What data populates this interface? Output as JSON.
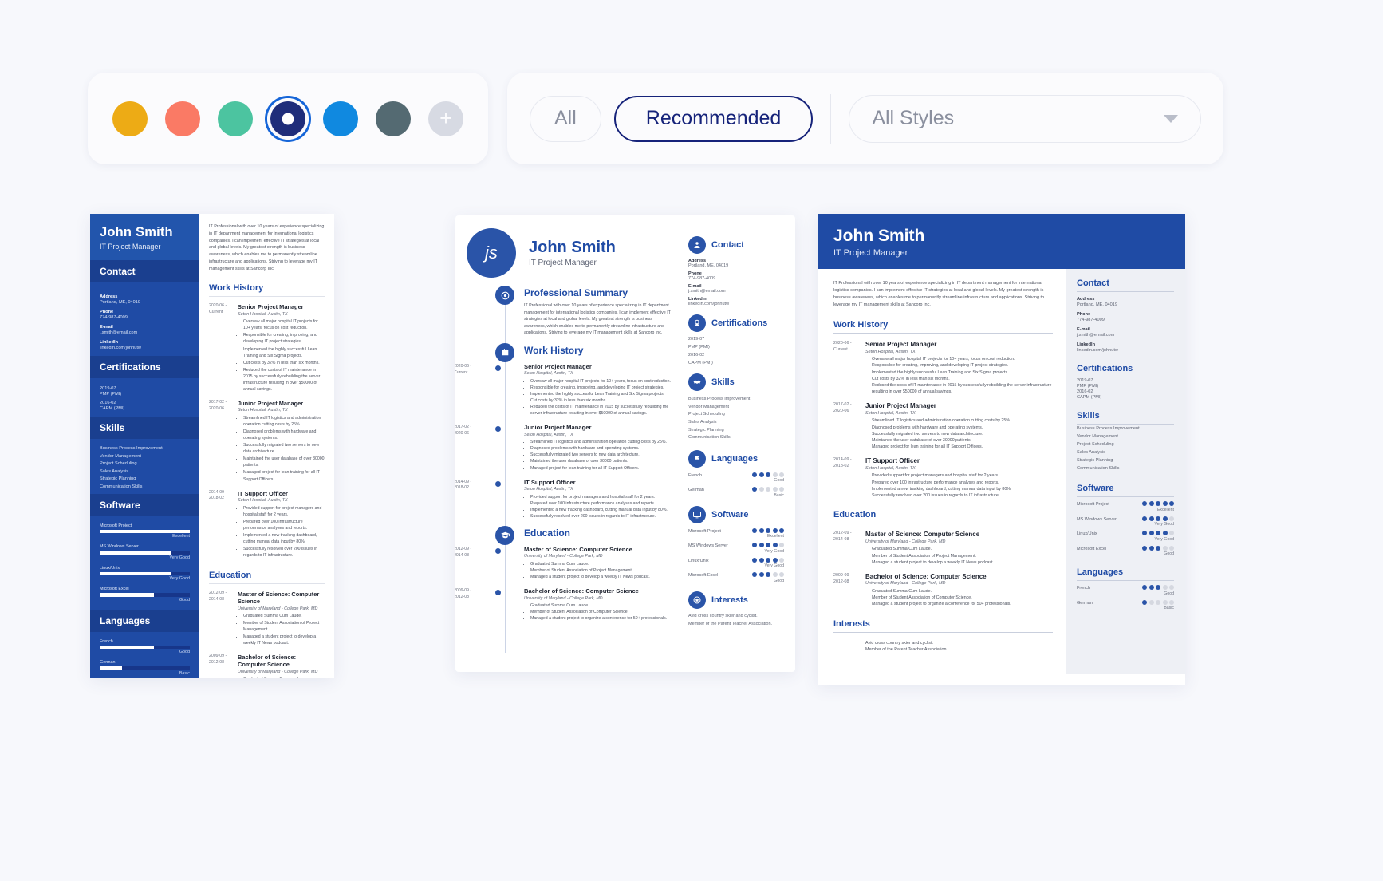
{
  "toolbar": {
    "colors": [
      {
        "name": "yellow",
        "hex": "#edab15",
        "selected": false
      },
      {
        "name": "coral",
        "hex": "#fa7a65",
        "selected": false
      },
      {
        "name": "teal",
        "hex": "#4cc4a0",
        "selected": false
      },
      {
        "name": "navy",
        "hex": "#1f2d7a",
        "selected": true
      },
      {
        "name": "blue",
        "hex": "#1089e0",
        "selected": false
      },
      {
        "name": "slate",
        "hex": "#546a72",
        "selected": false
      }
    ],
    "add_label": "+",
    "filters": [
      {
        "label": "All",
        "active": false
      },
      {
        "label": "Recommended",
        "active": true
      }
    ],
    "style_select": {
      "value": "All Styles"
    }
  },
  "resume": {
    "name": "John Smith",
    "initials": "js",
    "role": "IT Project Manager",
    "summary": "IT Professional with over 10 years of experience specializing in IT department management for international logistics companies. I can implement effective IT strategies at local and global levels. My greatest strength is business awareness, which enables me to permanently streamline infrastructure and applications. Striving to leverage my IT management skills at Sancorp Inc.",
    "sections": {
      "contact": "Contact",
      "certifications": "Certifications",
      "skills": "Skills",
      "software": "Software",
      "languages": "Languages",
      "summary": "Professional Summary",
      "work_history": "Work History",
      "education": "Education",
      "interests": "Interests"
    },
    "contact": [
      {
        "label": "Address",
        "value": "Portland, ME, 04019"
      },
      {
        "label": "Phone",
        "value": "774-987-4009"
      },
      {
        "label": "E-mail",
        "value": "j.smith@email.com"
      },
      {
        "label": "LinkedIn",
        "value": "linkedin.com/johnutw"
      }
    ],
    "certifications": [
      {
        "date": "2019-07",
        "name": "PMP (PMI)"
      },
      {
        "date": "2016-02",
        "name": "CAPM (PMI)"
      }
    ],
    "skills": [
      "Business Process Improvement",
      "Vendor Management",
      "Project Scheduling",
      "Sales Analysis",
      "Strategic Planning",
      "Communication Skills"
    ],
    "software": [
      {
        "name": "Microsoft Project",
        "level": "Excellent",
        "dots": 5,
        "pct": 100
      },
      {
        "name": "MS Windows Server",
        "level": "Very Good",
        "dots": 4,
        "pct": 80
      },
      {
        "name": "Linux/Unix",
        "level": "Very Good",
        "dots": 4,
        "pct": 80
      },
      {
        "name": "Microsoft Excel",
        "level": "Good",
        "dots": 3,
        "pct": 60
      }
    ],
    "languages": [
      {
        "name": "French",
        "level": "Good",
        "dots": 3,
        "pct": 60
      },
      {
        "name": "German",
        "level": "Basic",
        "dots": 1,
        "pct": 25
      }
    ],
    "jobs": [
      {
        "dates": "2020-06 - Current",
        "date_from": "2020-06 -",
        "date_to": "Current",
        "title": "Senior Project Manager",
        "org": "Seton Hospital, Austin, TX",
        "bullets": [
          "Oversaw all major hospital IT projects for 10+ years, focus on cost reduction.",
          "Responsible for creating, improving, and developing IT project strategies.",
          "Implemented the highly successful Lean Training and Six Sigma projects.",
          "Cut costs by 32% in less than six months.",
          "Reduced the costs of IT maintenance in 2015 by successfully rebuilding the server infrastructure resulting in over $50000 of annual savings."
        ]
      },
      {
        "dates": "2017-02 - 2020-06",
        "date_from": "2017-02 -",
        "date_to": "2020-06",
        "title": "Junior Project Manager",
        "org": "Seton Hospital, Austin, TX",
        "bullets": [
          "Streamlined IT logistics and administration operation cutting costs by 25%.",
          "Diagnosed problems with hardware and operating systems.",
          "Successfully migrated two servers to new data architecture.",
          "Maintained the user database of over 30000 patients.",
          "Managed project for lean training for all IT Support Officers."
        ]
      },
      {
        "dates": "2014-09 - 2018-02",
        "date_from": "2014-09 -",
        "date_to": "2018-02",
        "title": "IT Support Officer",
        "org": "Seton Hospital, Austin, TX",
        "bullets": [
          "Provided support for project managers and hospital staff for 2 years.",
          "Prepared over 100 infrastructure performance analyses and reports.",
          "Implemented a new tracking dashboard, cutting manual data input by 80%.",
          "Successfully resolved over 200 issues in regards to IT infrastructure."
        ]
      }
    ],
    "education": [
      {
        "dates": "2012-09 - 2014-08",
        "date_from": "2012-09 -",
        "date_to": "2014-08",
        "degree": "Master of Science: Computer Science",
        "school": "University of Maryland - College Park, MD",
        "bullets": [
          "Graduated Summa Cum Laude.",
          "Member of Student Association of Project Management.",
          "Managed a student project to develop a weekly IT News podcast."
        ]
      },
      {
        "dates": "2009-09 - 2012-08",
        "date_from": "2009-09 -",
        "date_to": "2012-08",
        "degree": "Bachelor of Science: Computer Science",
        "school": "University of Maryland - College Park, MD",
        "bullets": [
          "Graduated Summa Cum Laude.",
          "Member of Student Association of Computer Science.",
          "Managed a student project to organize a conference for 50+ professionals."
        ]
      }
    ],
    "interests": [
      "Avid cross country skier and cyclist.",
      "Member of the Parent Teacher Association."
    ]
  }
}
